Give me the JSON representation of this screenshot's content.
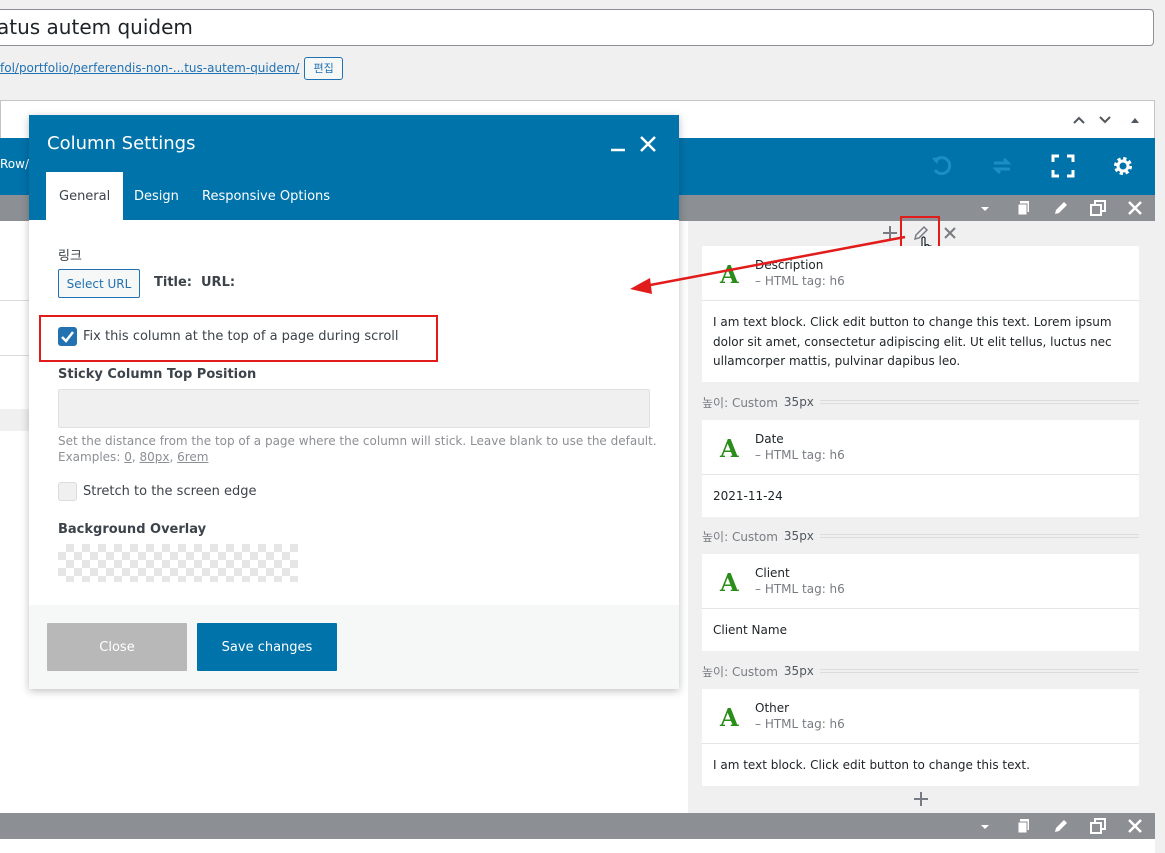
{
  "post": {
    "title_value": "atus autem quidem",
    "permalink_prefix": "fol/portfolio/",
    "permalink_slug": "perferendis-non-...tus-autem-quidem/",
    "edit_label": "편집"
  },
  "builder": {
    "row_tab_label": "Row/",
    "collapse_icons": [
      "chevron-up-icon",
      "chevron-down-icon",
      "triangle-up-icon"
    ],
    "toolbar_icons": [
      "undo-icon",
      "redo-icon",
      "fullscreen-icon",
      "gear-icon"
    ],
    "row_bar_icons": [
      "caret-down-icon",
      "copy-icon",
      "pencil-icon",
      "duplicate-icon",
      "close-icon"
    ]
  },
  "column_controls": [
    "plus-icon",
    "pencil-icon",
    "close-icon"
  ],
  "elements": [
    {
      "name": "Description",
      "tag": "– HTML tag: h6",
      "glyph": "A",
      "body": "I am text block. Click edit button to change this text. Lorem ipsum dolor sit amet, consectetur adipiscing elit. Ut elit tellus, luctus nec ullamcorper mattis, pulvinar dapibus leo."
    },
    {
      "name": "Date",
      "tag": "– HTML tag: h6",
      "glyph": "A",
      "body": "2021-11-24"
    },
    {
      "name": "Client",
      "tag": "– HTML tag: h6",
      "glyph": "A",
      "body": "Client Name"
    },
    {
      "name": "Other",
      "tag": "– HTML tag: h6",
      "glyph": "A",
      "body": "I am text block. Click edit button to change this text."
    }
  ],
  "spacers": [
    {
      "label": "높이: Custom",
      "value": "35px"
    },
    {
      "label": "높이: Custom",
      "value": "35px"
    },
    {
      "label": "높이: Custom",
      "value": "35px"
    }
  ],
  "modal": {
    "title": "Column Settings",
    "tabs": [
      {
        "label": "General",
        "active": true
      },
      {
        "label": "Design",
        "active": false
      },
      {
        "label": "Responsive Options",
        "active": false
      }
    ],
    "link_label": "링크",
    "select_url_label": "Select URL",
    "title_label": "Title:",
    "url_label": "URL:",
    "sticky_checkbox_label": "Fix this column at the top of a page during scroll",
    "sticky_checked": true,
    "top_position_label": "Sticky Column Top Position",
    "top_position_value": "",
    "help_text": "Set the distance from the top of a page where the column will stick. Leave blank to use the default.",
    "help_examples_prefix": "Examples:",
    "help_examples": [
      "0",
      "80px",
      "6rem"
    ],
    "stretch_label": "Stretch to the screen edge",
    "stretch_checked": false,
    "overlay_label": "Background Overlay",
    "close_label": "Close",
    "save_label": "Save changes"
  },
  "colors": {
    "primary": "#0073aa",
    "highlight": "#e21b1b",
    "glyph": "#2a8d19",
    "bar_gray": "#8c8f94"
  }
}
